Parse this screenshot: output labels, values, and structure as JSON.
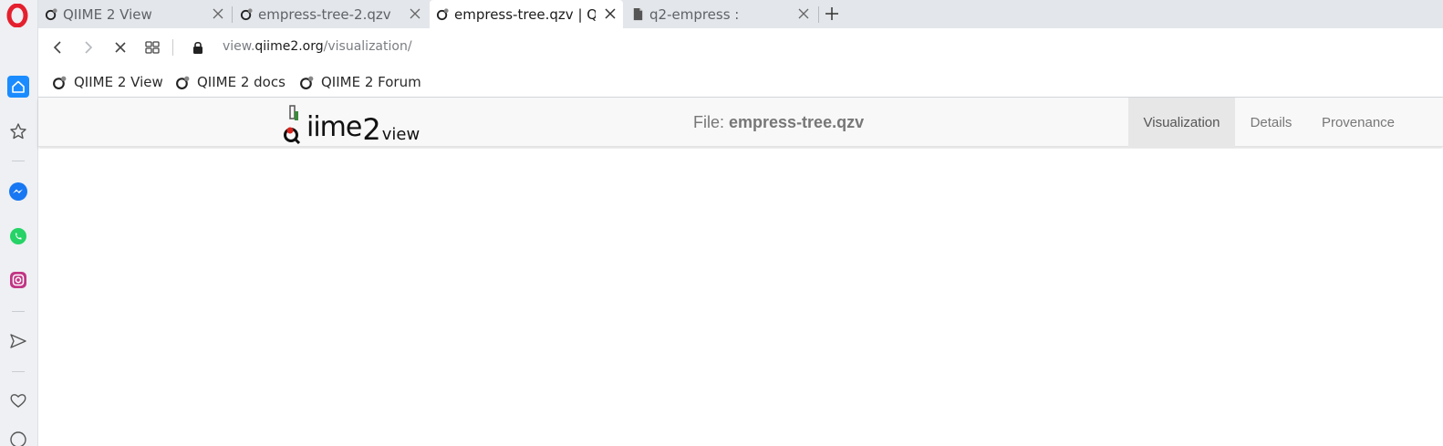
{
  "browser": {
    "tabs": [
      {
        "title": "QIIME 2 View",
        "icon": "qiime-favicon",
        "active": false
      },
      {
        "title": "empress-tree-2.qzv |",
        "icon": "qiime-favicon",
        "active": false
      },
      {
        "title": "empress-tree.qzv | QI",
        "icon": "qiime-favicon",
        "active": true
      },
      {
        "title": "q2-empress :",
        "icon": "document-icon",
        "active": false
      }
    ],
    "new_tab_label": "+",
    "url": {
      "prefix": "view.",
      "host": "qiime2.org",
      "path": "/visualization/"
    },
    "bookmarks": [
      {
        "label": "QIIME 2 View",
        "icon": "qiime-favicon"
      },
      {
        "label": "QIIME 2 docs",
        "icon": "qiime-favicon"
      },
      {
        "label": "QIIME 2 Forum",
        "icon": "qiime-favicon"
      }
    ]
  },
  "sidebar": {
    "items": [
      "opera-logo",
      "home-icon",
      "star-icon",
      "messenger-icon",
      "whatsapp-icon",
      "instagram-icon",
      "send-icon",
      "heart-icon"
    ]
  },
  "qiime": {
    "logo": {
      "q": "qiime",
      "two": "2",
      "view": "view"
    },
    "file_label": "File: ",
    "file_name": "empress-tree.qzv",
    "nav_tabs": [
      {
        "label": "Visualization",
        "active": true
      },
      {
        "label": "Details",
        "active": false
      },
      {
        "label": "Provenance",
        "active": false
      }
    ]
  },
  "colors": {
    "opera_red": "#e5202e",
    "home_blue": "#1a8cff",
    "messenger_blue": "#1877f2",
    "whatsapp_green": "#25d366",
    "instagram_pink": "#c13584"
  }
}
